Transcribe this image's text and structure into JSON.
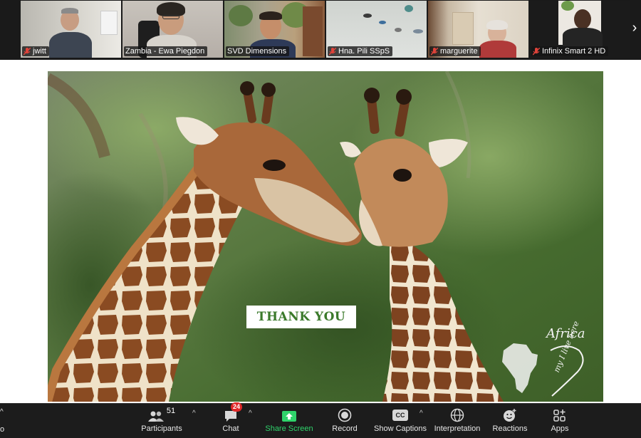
{
  "participants": [
    {
      "name": "jwitt",
      "muted": true
    },
    {
      "name": "Zambia - Ewa Piegdon",
      "muted": false
    },
    {
      "name": "SVD Dimensions",
      "muted": false,
      "active_speaker": true
    },
    {
      "name": "Hna. Pili SSpS",
      "muted": true
    },
    {
      "name": "marguerite",
      "muted": true
    },
    {
      "name": "Infinix Smart 2 HD",
      "muted": true
    }
  ],
  "share": {
    "banner_text": "THANK YOU",
    "logo_title": "Africa",
    "logo_tagline": "my I live here"
  },
  "toolbar": {
    "left_cut_caret": "^",
    "left_cut_label": "o",
    "participants_label": "Participants",
    "participants_count": "51",
    "chat_label": "Chat",
    "chat_badge": "24",
    "share_label": "Share Screen",
    "record_label": "Record",
    "captions_label": "Show Captions",
    "captions_icon_text": "CC",
    "interpretation_label": "Interpretation",
    "reactions_label": "Reactions",
    "apps_label": "Apps",
    "caret": "^"
  },
  "colors": {
    "share_accent": "#2fd36b",
    "badge": "#e02828",
    "muted_icon": "#e0433a",
    "active_border": "#9ed36a",
    "banner_text": "#3b7a2b"
  }
}
